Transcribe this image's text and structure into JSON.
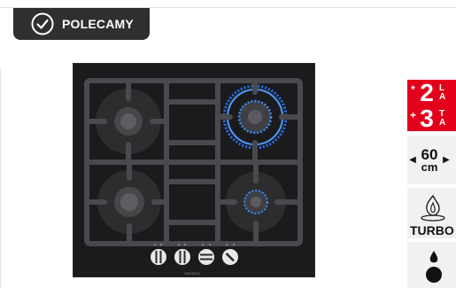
{
  "badge": {
    "label": "POLECAMY",
    "icon": "check-circle-icon"
  },
  "product": {
    "brand": "SIEMENS",
    "image_alt": "Gas hob with 4 burners, black glass",
    "knob_count": 4
  },
  "features": {
    "warranty": {
      "rows": [
        {
          "symbol": "*",
          "number": "2",
          "text": [
            "L",
            "A"
          ]
        },
        {
          "symbol": "+",
          "number": "3",
          "text": [
            "T",
            "A"
          ]
        }
      ],
      "bg_color": "#e3001b"
    },
    "size": {
      "number": "60",
      "unit": "cm",
      "left_arrow": "◀",
      "right_arrow": "▶"
    },
    "turbo": {
      "label": "TURBO",
      "icon": "turbo-flame-icon"
    },
    "flame": {
      "icon": "flame-drop-icon"
    }
  }
}
